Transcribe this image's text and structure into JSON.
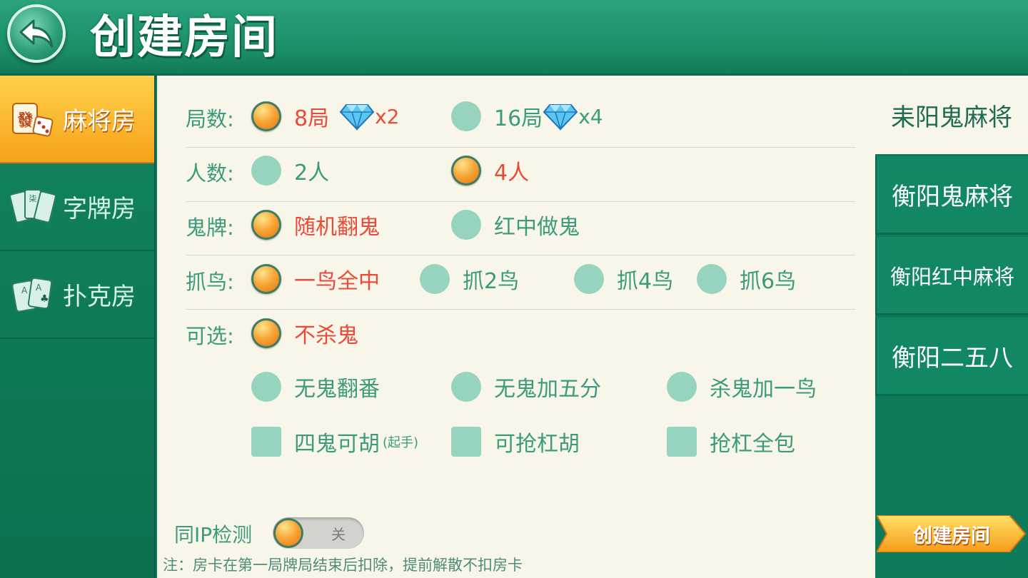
{
  "header": {
    "title": "创建房间"
  },
  "left_nav": {
    "items": [
      {
        "label": "麻将房",
        "icon": "mahjong-tile-dice-icon",
        "active": true
      },
      {
        "label": "字牌房",
        "icon": "zipai-cards-icon",
        "active": false
      },
      {
        "label": "扑克房",
        "icon": "poker-cards-icon",
        "active": false
      }
    ]
  },
  "rows": {
    "rounds": {
      "label": "局数:",
      "options": [
        {
          "text": "8局",
          "multiplier": "x2",
          "selected": true
        },
        {
          "text": "16局",
          "multiplier": "x4",
          "selected": false
        }
      ]
    },
    "players": {
      "label": "人数:",
      "options": [
        {
          "text": "2人",
          "selected": false
        },
        {
          "text": "4人",
          "selected": true
        }
      ]
    },
    "ghost": {
      "label": "鬼牌:",
      "options": [
        {
          "text": "随机翻鬼",
          "selected": true
        },
        {
          "text": "红中做鬼",
          "selected": false
        }
      ]
    },
    "bird": {
      "label": "抓鸟:",
      "options": [
        {
          "text": "一鸟全中",
          "selected": true
        },
        {
          "text": "抓2鸟",
          "selected": false
        },
        {
          "text": "抓4鸟",
          "selected": false
        },
        {
          "text": "抓6鸟",
          "selected": false
        }
      ]
    },
    "optional": {
      "label": "可选:",
      "options": [
        {
          "text": "不杀鬼",
          "selected": true
        },
        {
          "text": "无鬼翻番",
          "selected": false
        },
        {
          "text": "无鬼加五分",
          "selected": false
        },
        {
          "text": "杀鬼加一鸟",
          "selected": false
        }
      ],
      "checkboxes": [
        {
          "text": "四鬼可胡",
          "suffix": "(起手)",
          "checked": false
        },
        {
          "text": "可抢杠胡",
          "checked": false
        },
        {
          "text": "抢杠全包",
          "checked": false
        }
      ]
    }
  },
  "ip_check": {
    "label": "同IP检测",
    "state_text": "关",
    "on": false
  },
  "note": "注：房卡在第一局牌局结束后扣除，提前解散不扣房卡",
  "right_nav": {
    "items": [
      {
        "label": "耒阳鬼麻将",
        "active": true
      },
      {
        "label": "衡阳鬼麻将",
        "active": false
      },
      {
        "label": "衡阳红中麻将",
        "active": false
      },
      {
        "label": "衡阳二五八",
        "active": false
      }
    ]
  },
  "create_button": {
    "label": "创建房间"
  },
  "colors": {
    "accent_green": "#3c9b7c",
    "selected_red": "#ea4a3a",
    "panel_bg": "#f7f6e8",
    "active_tab_orange": "#f6a21b"
  }
}
